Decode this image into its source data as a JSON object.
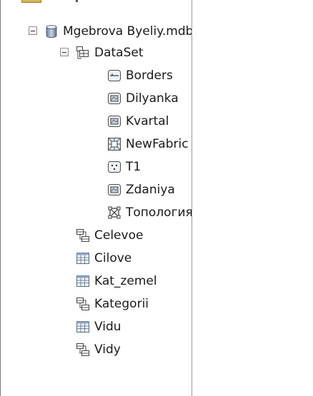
{
  "tree": {
    "root": {
      "label": "Mgebrova Byeliy.mdb",
      "icon": "database-icon",
      "expanded": true
    },
    "dataset": {
      "label": "DataSet",
      "icon": "feature-dataset-icon",
      "expanded": true
    },
    "dataset_children": [
      {
        "label": "Borders",
        "icon": "line-feature-class-icon"
      },
      {
        "label": "Dilyanka",
        "icon": "polygon-feature-class-icon"
      },
      {
        "label": "Kvartal",
        "icon": "polygon-feature-class-icon"
      },
      {
        "label": "NewFabric",
        "icon": "parcel-fabric-icon"
      },
      {
        "label": "T1",
        "icon": "point-feature-class-icon"
      },
      {
        "label": "Zdaniya",
        "icon": "polygon-feature-class-icon"
      },
      {
        "label": "Топология",
        "icon": "topology-icon"
      }
    ],
    "root_children": [
      {
        "label": "Celevoe",
        "icon": "relationship-class-icon"
      },
      {
        "label": "Cilove",
        "icon": "table-icon"
      },
      {
        "label": "Kat_zemel",
        "icon": "table-icon"
      },
      {
        "label": "Kategorii",
        "icon": "relationship-class-icon"
      },
      {
        "label": "Vidu",
        "icon": "table-icon"
      },
      {
        "label": "Vidy",
        "icon": "relationship-class-icon"
      }
    ]
  }
}
